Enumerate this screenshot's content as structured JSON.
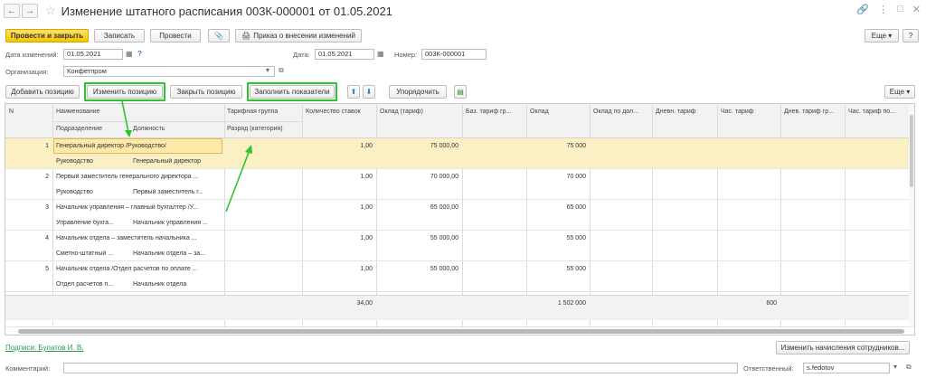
{
  "window": {
    "title": "Изменение штатного расписания 003К-000001 от 01.05.2021",
    "back_glyph": "←",
    "forward_glyph": "→",
    "star_glyph": "☆",
    "link_glyph": "🔗",
    "menu_glyph": "⋮",
    "max_glyph": "□",
    "close_glyph": "✕"
  },
  "toolbar": {
    "post_close": "Провести и закрыть",
    "save": "Записать",
    "post": "Провести",
    "attach_glyph": "📎",
    "print_glyph": "🖨",
    "order": "Приказ о внесении изменений",
    "more": "Еще ▾",
    "help": "?"
  },
  "form": {
    "change_date_label": "Дата изменений:",
    "change_date_value": "01.05.2021",
    "date_label": "Дата:",
    "date_value": "01.05.2021",
    "number_label": "Номер:",
    "number_value": "003К-000001",
    "org_label": "Организация:",
    "org_value": "Конфетпром",
    "calendar_glyph": "▦",
    "dropdown_glyph": "▾",
    "open_glyph": "⧉",
    "help_glyph": "?"
  },
  "table_toolbar": {
    "add_position": "Добавить позицию",
    "change_position": "Изменить позицию",
    "close_position": "Закрыть позицию",
    "fill_indicators": "Заполнить показатели",
    "up_glyph": "⬆",
    "down_glyph": "⬇",
    "arrange": "Упорядочить",
    "excel_glyph": "▤",
    "more": "Еще ▾"
  },
  "table": {
    "headers": {
      "n": "N",
      "name": "Наименование",
      "subdivision": "Подразделение",
      "position": "Должность",
      "tariff_group": "Тарифная группа",
      "grade": "Разряд (категория)",
      "rate_count": "Количество ставок",
      "salary_tariff": "Оклад (тариф)",
      "base_tariff": "Баз. тариф гр...",
      "salary": "Оклад",
      "salary_per_position": "Оклад по дол...",
      "daily_tariff": "Дневн. тариф",
      "hourly_tariff": "Час. тариф",
      "daily_tariff_group": "Днев. тариф гр...",
      "hourly_tariff_group": "Час. тариф по..."
    },
    "rows": [
      {
        "n": "1",
        "name": "Генеральный директор /Руководство/",
        "subdivision": "Руководство",
        "position": "Генеральный директор",
        "rate_count": "1,00",
        "salary_tariff": "75 000,00",
        "salary": "75 000"
      },
      {
        "n": "2",
        "name": "Первый заместитель генерального директора ...",
        "subdivision": "Руководство",
        "position": "Первый заместитель г...",
        "rate_count": "1,00",
        "salary_tariff": "70 000,00",
        "salary": "70 000"
      },
      {
        "n": "3",
        "name": "Начальник управления – главный бухгалтер /У...",
        "subdivision": "Управление бухга...",
        "position": "Начальник управления ...",
        "rate_count": "1,00",
        "salary_tariff": "65 000,00",
        "salary": "65 000"
      },
      {
        "n": "4",
        "name": "Начальник отдела – заместитель начальника ...",
        "subdivision": "Сметно-штатный ...",
        "position": "Начальник отдела – за...",
        "rate_count": "1,00",
        "salary_tariff": "55 000,00",
        "salary": "55 000"
      },
      {
        "n": "5",
        "name": "Начальник отдела /Отдел расчетов по оплате ...",
        "subdivision": "Отдел расчетов п...",
        "position": "Начальник отдела",
        "rate_count": "1,00",
        "salary_tariff": "55 000,00",
        "salary": "55 000"
      }
    ],
    "totals": {
      "rate_count": "34,00",
      "salary": "1 502 000",
      "hourly_tariff": "600"
    }
  },
  "footer": {
    "signatures_link": "Подписи: Булатов И. В.",
    "change_accruals": "Изменить начисления сотрудников...",
    "comment_label": "Комментарий:",
    "comment_value": "",
    "responsible_label": "Ответственный:",
    "responsible_value": "s.fedotov"
  },
  "colors": {
    "highlight": "#2ec42e",
    "selected_row": "#fbf0c4",
    "primary_button": "#f5c400"
  }
}
